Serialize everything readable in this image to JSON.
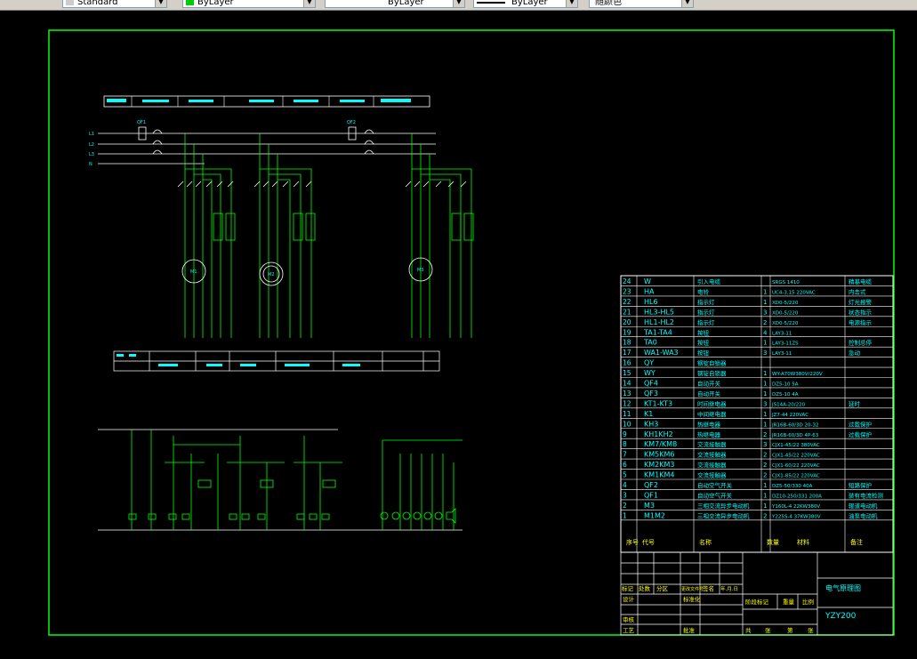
{
  "toolbar": {
    "dimstyle": "Standard",
    "layer": "ByLayer",
    "linetype": "ByLayer",
    "lineweight": "ByLayer",
    "plotstyle": "随颜色"
  },
  "colors": {
    "background": "#000000",
    "frame": "#00ff00",
    "text": "#00ffff",
    "wire": "#00ff00",
    "white": "#ffffff"
  },
  "power_labels": [
    "L1",
    "L2",
    "L3",
    "N"
  ],
  "breakers": [
    "QF1",
    "QF2",
    "QF3"
  ],
  "motors": [
    "M1",
    "M2",
    "M3"
  ],
  "bom": {
    "rows": [
      {
        "no": "24",
        "code": "W",
        "name": "引入电缆",
        "qty": "",
        "spec": "SRGS 1410",
        "note": "精基电缆"
      },
      {
        "no": "23",
        "code": "HA",
        "name": "电铃",
        "qty": "1",
        "spec": "UC4-3.15 220VAC",
        "note": "内击式"
      },
      {
        "no": "22",
        "code": "HL6",
        "name": "指示灯",
        "qty": "1",
        "spec": "XD0-5/220",
        "note": "灯光报警"
      },
      {
        "no": "21",
        "code": "HL3-HL5",
        "name": "指示灯",
        "qty": "3",
        "spec": "XD0-5/220",
        "note": "状态指示"
      },
      {
        "no": "20",
        "code": "HL1-HL2",
        "name": "指示灯",
        "qty": "2",
        "spec": "XD0-5/220",
        "note": "电源指示"
      },
      {
        "no": "19",
        "code": "TA1-TA4",
        "name": "按钮",
        "qty": "4",
        "spec": "LAY3-11",
        "note": ""
      },
      {
        "no": "18",
        "code": "TA0",
        "name": "按钮",
        "qty": "1",
        "spec": "LAY3-11ZS",
        "note": "控制总停"
      },
      {
        "no": "17",
        "code": "WA1-WA3",
        "name": "按钮",
        "qty": "3",
        "spec": "LAY3-11",
        "note": "急动"
      },
      {
        "no": "16",
        "code": "QY",
        "name": "钢锭自锁器",
        "qty": "",
        "spec": "",
        "note": ""
      },
      {
        "no": "15",
        "code": "WY",
        "name": "钢锭自锁器",
        "qty": "1",
        "spec": "WY-A70W380V/220V",
        "note": ""
      },
      {
        "no": "14",
        "code": "QF4",
        "name": "自动开关",
        "qty": "1",
        "spec": "DZ5-10 5A",
        "note": ""
      },
      {
        "no": "13",
        "code": "QF3",
        "name": "自动开关",
        "qty": "1",
        "spec": "DZ5-10 4A",
        "note": ""
      },
      {
        "no": "12",
        "code": "KT1-KT3",
        "name": "时间继电器",
        "qty": "3",
        "spec": "JS14A-20/220",
        "note": "延时"
      },
      {
        "no": "11",
        "code": "K1",
        "name": "中间继电器",
        "qty": "1",
        "spec": "JZ7-44 220VAC",
        "note": ""
      },
      {
        "no": "10",
        "code": "KH3",
        "name": "热继电器",
        "qty": "1",
        "spec": "JR16B-60/3D 20-32",
        "note": "过载保护"
      },
      {
        "no": "9",
        "code": "KH1KH2",
        "name": "热继电器",
        "qty": "2",
        "spec": "JR16B-60/3D 4P-63",
        "note": "过载保护"
      },
      {
        "no": "8",
        "code": "KM7/KM8",
        "name": "交流接触器",
        "qty": "3",
        "spec": "CJX1-45/22 380VAC",
        "note": ""
      },
      {
        "no": "7",
        "code": "KM5KM6",
        "name": "交流接触器",
        "qty": "2",
        "spec": "CJX1-45/22 220VAC",
        "note": ""
      },
      {
        "no": "6",
        "code": "KM2KM3",
        "name": "交流接触器",
        "qty": "2",
        "spec": "CJX1-60/22 220VAC",
        "note": ""
      },
      {
        "no": "5",
        "code": "KM1KM4",
        "name": "交流接触器",
        "qty": "2",
        "spec": "CJX1-85/22 220VAC",
        "note": ""
      },
      {
        "no": "4",
        "code": "QF2",
        "name": "自动空气开关",
        "qty": "1",
        "spec": "DZ5-50/330 40A",
        "note": "短路保护"
      },
      {
        "no": "3",
        "code": "QF1",
        "name": "自动空气开关",
        "qty": "1",
        "spec": "DZ10-250/331 200A",
        "note": "装有电流检测"
      },
      {
        "no": "2",
        "code": "M3",
        "name": "三相交流异步电动机",
        "qty": "1",
        "spec": "Y160L-4 22KW380V",
        "note": "辊道电动机"
      },
      {
        "no": "1",
        "code": "M1M2",
        "name": "三相交流异步电动机",
        "qty": "2",
        "spec": "Y225S-4 37KW380V",
        "note": "油泵电动机"
      }
    ],
    "header": {
      "no": "序号",
      "code": "代号",
      "name": "名称",
      "qty": "数量",
      "spec": "材料",
      "note": "备注"
    }
  },
  "title_block": {
    "drawing_name": "电气原理图",
    "drawing_no": "YZY200",
    "labels": [
      "标记",
      "处数",
      "分区",
      "更改文件号",
      "签名",
      "年.月.日",
      "设计",
      "标准化",
      "阶段标记",
      "重量",
      "比例",
      "审核",
      "工艺",
      "批准",
      "共",
      "张",
      "第",
      "张"
    ]
  }
}
